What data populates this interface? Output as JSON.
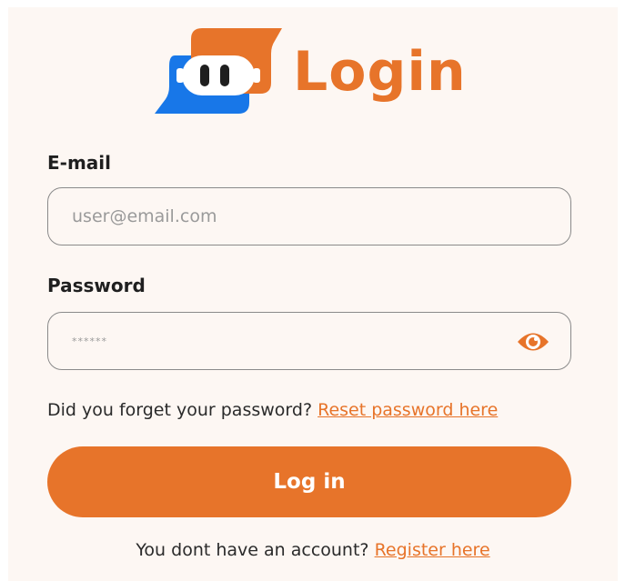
{
  "logo": {
    "title": "Login",
    "colors": {
      "orange": "#e7742a",
      "blue": "#1877e8"
    },
    "icon": "chat-robot-logo-icon"
  },
  "form": {
    "email": {
      "label": "E-mail",
      "placeholder": "user@email.com",
      "value": ""
    },
    "password": {
      "label": "Password",
      "value": "******",
      "toggle_icon": "eye-icon"
    },
    "forgot": {
      "text": "Did you forget your password?",
      "link": "Reset password here"
    },
    "submit_label": "Log in",
    "register": {
      "text": "You dont have an account?",
      "link": "Register here"
    }
  },
  "theme": {
    "accent": "#e7742a",
    "background": "#fdf7f3",
    "text": "#1f1f1f"
  }
}
